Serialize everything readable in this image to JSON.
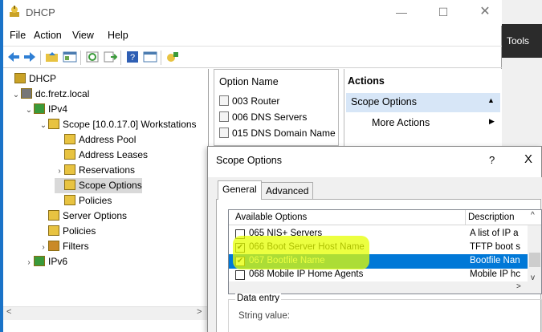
{
  "window": {
    "title": "DHCP"
  },
  "background": {
    "tools_label": "Tools"
  },
  "menu": [
    "File",
    "Action",
    "View",
    "Help"
  ],
  "toolbar": {
    "icons": [
      "back-icon",
      "forward-icon",
      "up-folder-icon",
      "show-hide-tree-icon",
      "refresh-icon",
      "export-list-icon",
      "help-icon",
      "properties-icon",
      "dhcp-manage-icon"
    ]
  },
  "tree": [
    {
      "label": "DHCP",
      "level": 0,
      "expander": "",
      "icon": "dhcp-icon"
    },
    {
      "label": "dc.fretz.local",
      "level": 1,
      "expander": "⌄",
      "icon": "server-icon"
    },
    {
      "label": "IPv4",
      "level": 2,
      "expander": "⌄",
      "icon": "ipv4-icon"
    },
    {
      "label": "Scope [10.0.17.0] Workstations",
      "level": 3,
      "expander": "⌄",
      "icon": "folder-open-icon"
    },
    {
      "label": "Address Pool",
      "level": 4,
      "expander": "",
      "icon": "address-pool-icon"
    },
    {
      "label": "Address Leases",
      "level": 4,
      "expander": "",
      "icon": "address-leases-icon"
    },
    {
      "label": "Reservations",
      "level": 4,
      "expander": "›",
      "icon": "reservations-icon"
    },
    {
      "label": "Scope Options",
      "level": 4,
      "expander": "",
      "icon": "scope-options-icon",
      "selected": true
    },
    {
      "label": "Policies",
      "level": 4,
      "expander": "",
      "icon": "policies-icon"
    },
    {
      "label": "Server Options",
      "level": 3,
      "expander": "",
      "icon": "server-options-icon"
    },
    {
      "label": "Policies",
      "level": 3,
      "expander": "",
      "icon": "policies-icon"
    },
    {
      "label": "Filters",
      "level": 3,
      "expander": "›",
      "icon": "filters-icon"
    },
    {
      "label": "IPv6",
      "level": 2,
      "expander": "›",
      "icon": "ipv6-icon"
    }
  ],
  "list": {
    "header": "Option Name",
    "rows": [
      "003 Router",
      "006 DNS Servers",
      "015 DNS Domain Name"
    ]
  },
  "actions": {
    "title": "Actions",
    "section": "Scope Options",
    "more": "More Actions"
  },
  "dialog": {
    "title": "Scope Options",
    "help": "?",
    "close": "X",
    "tabs": [
      "General",
      "Advanced"
    ],
    "options_header": {
      "name": "Available Options",
      "desc": "Description"
    },
    "options": [
      {
        "name": "065 NIS+ Servers",
        "desc": "A list of IP a",
        "checked": false,
        "selected": false
      },
      {
        "name": "066 Boot Server Host Name",
        "desc": "TFTP boot s",
        "checked": true,
        "selected": false
      },
      {
        "name": "067 Bootfile Name",
        "desc": "Bootfile Nan",
        "checked": true,
        "selected": true
      },
      {
        "name": "068 Mobile IP Home Agents",
        "desc": "Mobile IP hc",
        "checked": false,
        "selected": false
      }
    ],
    "data_entry_label": "Data entry",
    "string_value_label": "String value:"
  },
  "colors": {
    "selection": "#0078d7",
    "highlight": "#e6ff00",
    "tree_selected": "#d9d9d9",
    "action_header": "#d7e6f7"
  }
}
